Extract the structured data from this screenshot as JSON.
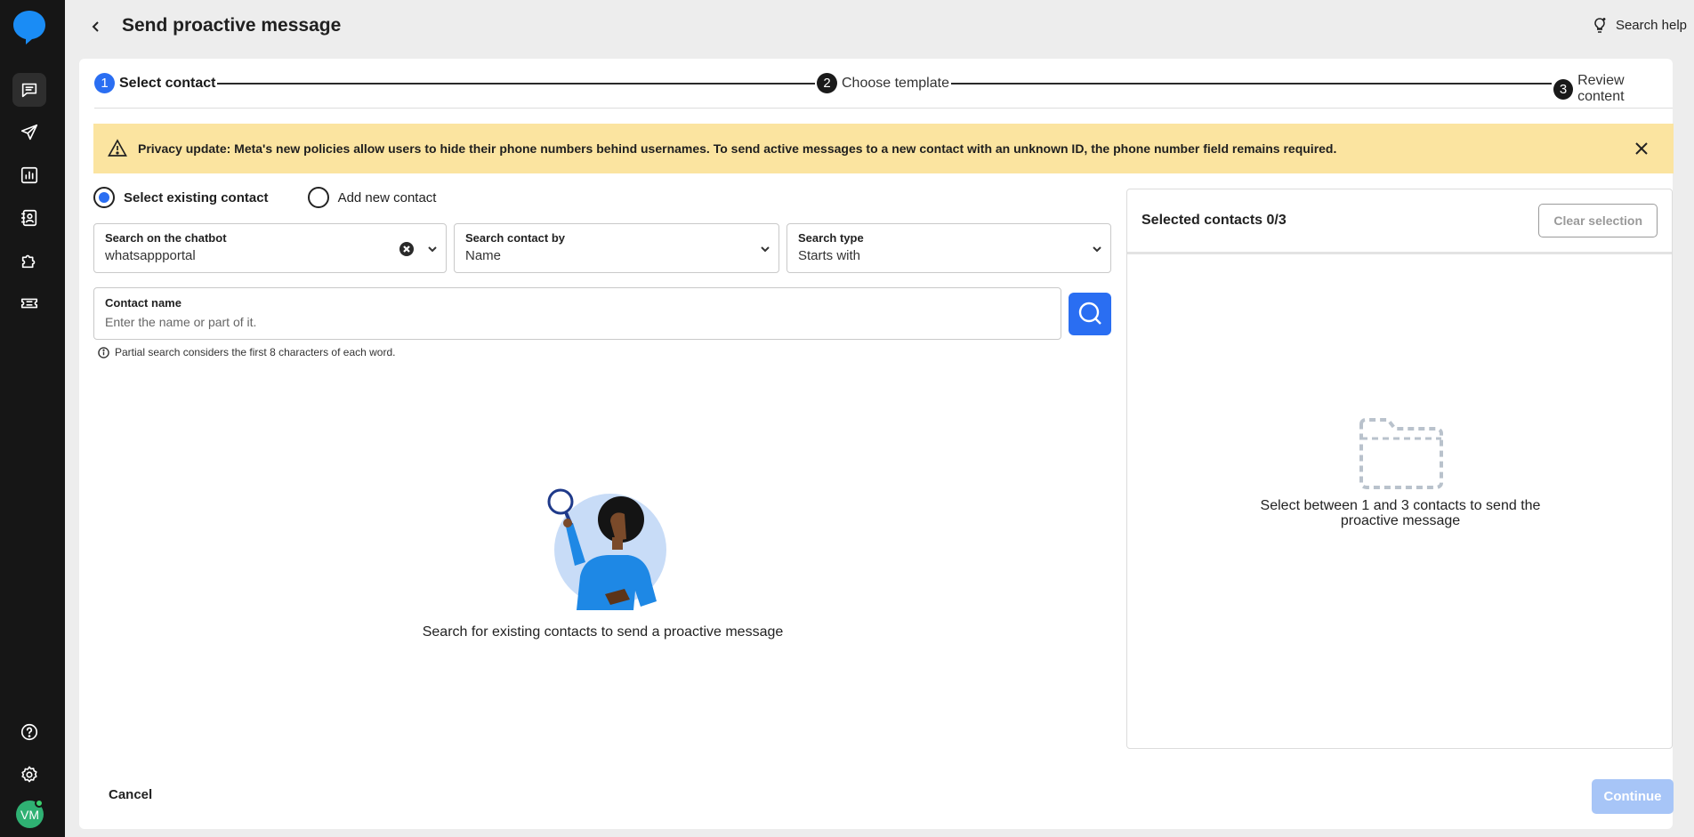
{
  "sidebar": {
    "nav": [
      {
        "icon": "chat-icon"
      },
      {
        "icon": "send-icon"
      },
      {
        "icon": "analytics-icon"
      },
      {
        "icon": "contacts-icon"
      },
      {
        "icon": "puzzle-icon"
      },
      {
        "icon": "ticket-icon"
      }
    ],
    "bottom": [
      {
        "icon": "help-icon"
      },
      {
        "icon": "gear-icon"
      }
    ],
    "avatar_initials": "VM"
  },
  "header": {
    "title": "Send proactive message",
    "help_label": "Search help"
  },
  "stepper": {
    "steps": [
      {
        "number": "1",
        "label": "Select contact",
        "active": true
      },
      {
        "number": "2",
        "label": "Choose template",
        "active": false
      },
      {
        "number": "3",
        "label": "Review content",
        "active": false
      }
    ]
  },
  "banner": {
    "text": "Privacy update: Meta's new policies allow users to hide their phone numbers behind usernames. To send active messages to a new contact with an unknown ID, the phone number field remains required.",
    "color": "#fbe4a0"
  },
  "contact_mode": {
    "options": [
      {
        "label": "Select existing contact",
        "checked": true
      },
      {
        "label": "Add new contact",
        "checked": false
      }
    ]
  },
  "filters": {
    "chatbot": {
      "label": "Search on the chatbot",
      "value": "whatsappportal"
    },
    "search_by": {
      "label": "Search contact by",
      "value": "Name"
    },
    "search_type": {
      "label": "Search type",
      "value": "Starts with"
    }
  },
  "contact_name": {
    "label": "Contact name",
    "placeholder": "Enter the name or part of it."
  },
  "hint": "Partial search considers the first 8 characters of each word.",
  "empty_state": "Search for existing contacts to send a proactive message",
  "selected_panel": {
    "title": "Selected contacts 0/3",
    "clear_label": "Clear selection",
    "empty_text": "Select between 1 and 3 contacts to send the proactive message"
  },
  "footer": {
    "cancel_label": "Cancel",
    "continue_label": "Continue"
  },
  "colors": {
    "accent": "#2a6ef2",
    "continue_disabled": "#a7c5f7",
    "sidebar": "#161616"
  }
}
